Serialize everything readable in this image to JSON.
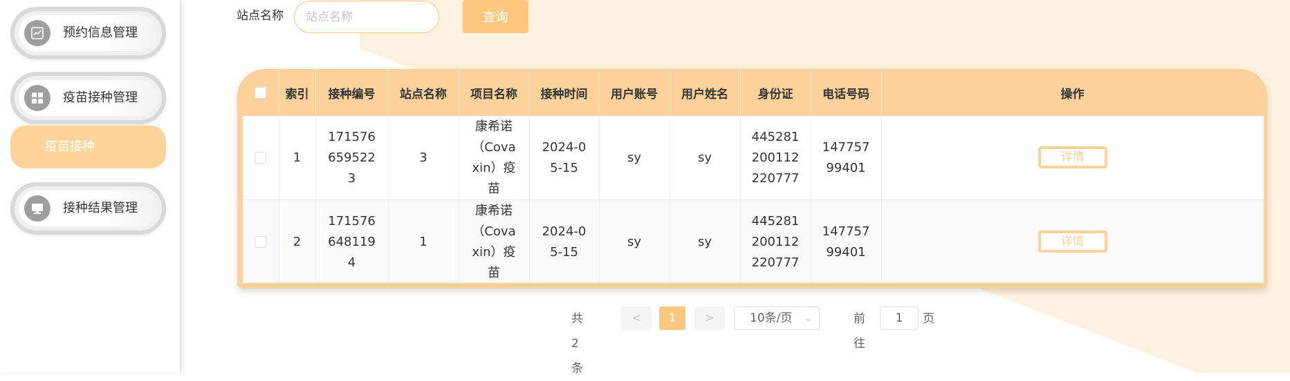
{
  "colors": {
    "accent": "#fec77f",
    "header_bg": "#fdd29a",
    "background_shape": "#fff1df",
    "icon_circle": "#9e9e9e"
  },
  "sidebar": {
    "items": [
      {
        "label": "预约信息管理",
        "icon": "trend-chart-icon"
      },
      {
        "label": "疫苗接种管理",
        "icon": "grid-icon"
      },
      {
        "label": "接种结果管理",
        "icon": "monitor-icon"
      }
    ],
    "active_sub_item": "疫苗接种"
  },
  "search": {
    "label": "站点名称",
    "placeholder": "站点名称",
    "value": "",
    "button_label": "查询"
  },
  "table": {
    "columns": [
      "索引",
      "接种编号",
      "站点名称",
      "项目名称",
      "接种时间",
      "用户账号",
      "用户姓名",
      "身份证",
      "电话号码",
      "操作"
    ],
    "rows": [
      {
        "index": "1",
        "code": "1715766595223",
        "site": "3",
        "project": "康希诺（Covaxin）疫苗",
        "time": "2024-05-15",
        "account": "sy",
        "name": "sy",
        "id_card": "445281200112220777",
        "phone": "14775799401",
        "action": "详情"
      },
      {
        "index": "2",
        "code": "1715766481194",
        "site": "1",
        "project": "康希诺（Covaxin）疫苗",
        "time": "2024-05-15",
        "account": "sy",
        "name": "sy",
        "id_card": "445281200112220777",
        "phone": "14775799401",
        "action": "详情"
      }
    ]
  },
  "pagination": {
    "total_text": "共 2 条",
    "prev": "<",
    "current_page": "1",
    "next": ">",
    "page_size": "10条/页",
    "goto_label": "前往",
    "goto_value": "1",
    "page_suffix": "页"
  }
}
